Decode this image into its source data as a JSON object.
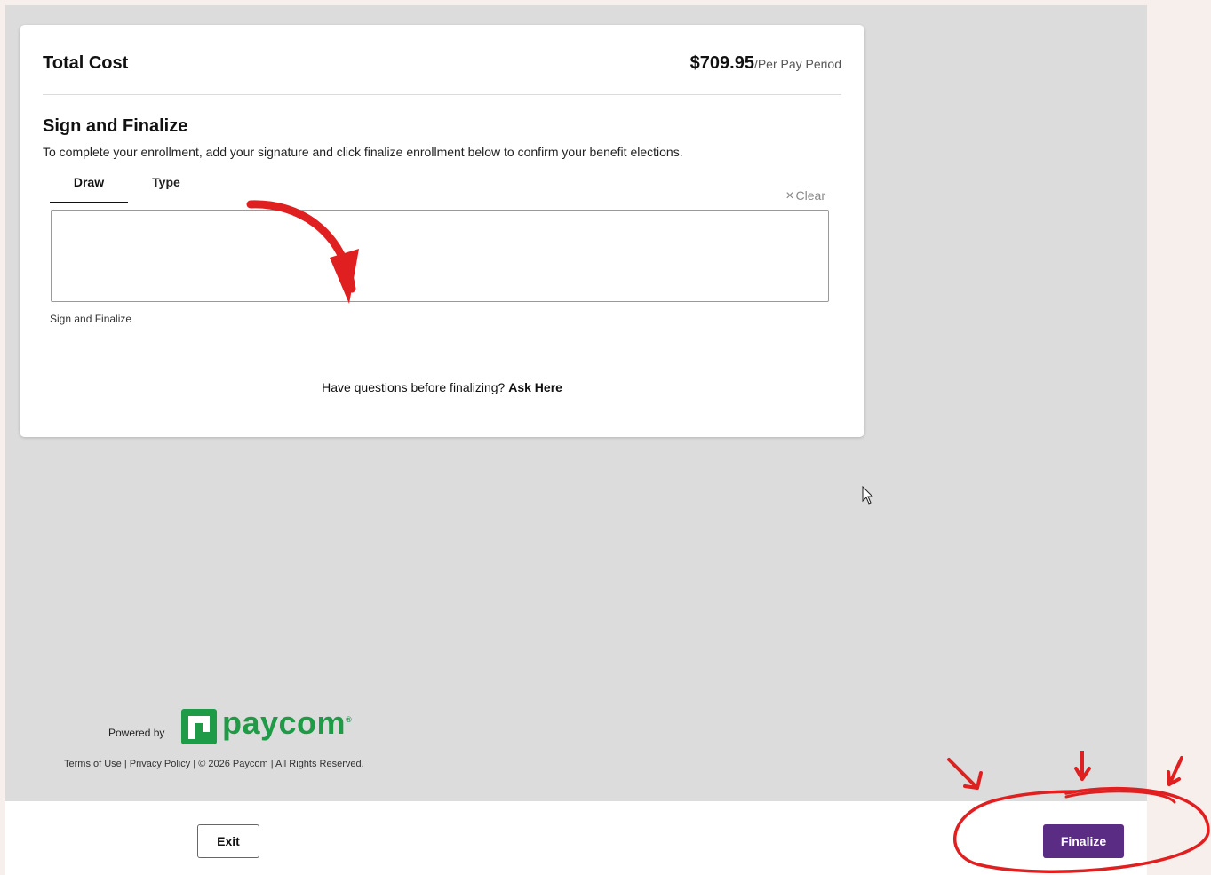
{
  "total": {
    "label": "Total Cost",
    "amount": "$709.95",
    "period": "/Per Pay Period"
  },
  "sign": {
    "title": "Sign and Finalize",
    "description": "To complete your enrollment, add your signature and click finalize enrollment below to confirm your benefit elections.",
    "tabs": [
      {
        "label": "Draw",
        "active": true
      },
      {
        "label": "Type",
        "active": false
      }
    ],
    "clear_label": "Clear",
    "caption": "Sign and Finalize"
  },
  "questions": {
    "text": "Have questions before finalizing?",
    "link": "Ask Here"
  },
  "footer": {
    "powered_by": "Powered by",
    "brand": "paycom",
    "brand_mark": "®",
    "terms": "Terms of Use",
    "separator": " | ",
    "privacy": "Privacy Policy",
    "copyright": "© 2026 Paycom | All Rights Reserved."
  },
  "actions": {
    "exit_label": "Exit",
    "finalize_label": "Finalize"
  },
  "colors": {
    "accent": "#5b2c83",
    "brand_green": "#1f9a47",
    "annotation_red": "#e02020",
    "app_background": "#dcdcdc",
    "outer_background": "#f6efec"
  },
  "icons": {
    "clear": "close-icon",
    "cursor": "mouse-pointer-icon",
    "logo": "paycom-logo-icon"
  }
}
